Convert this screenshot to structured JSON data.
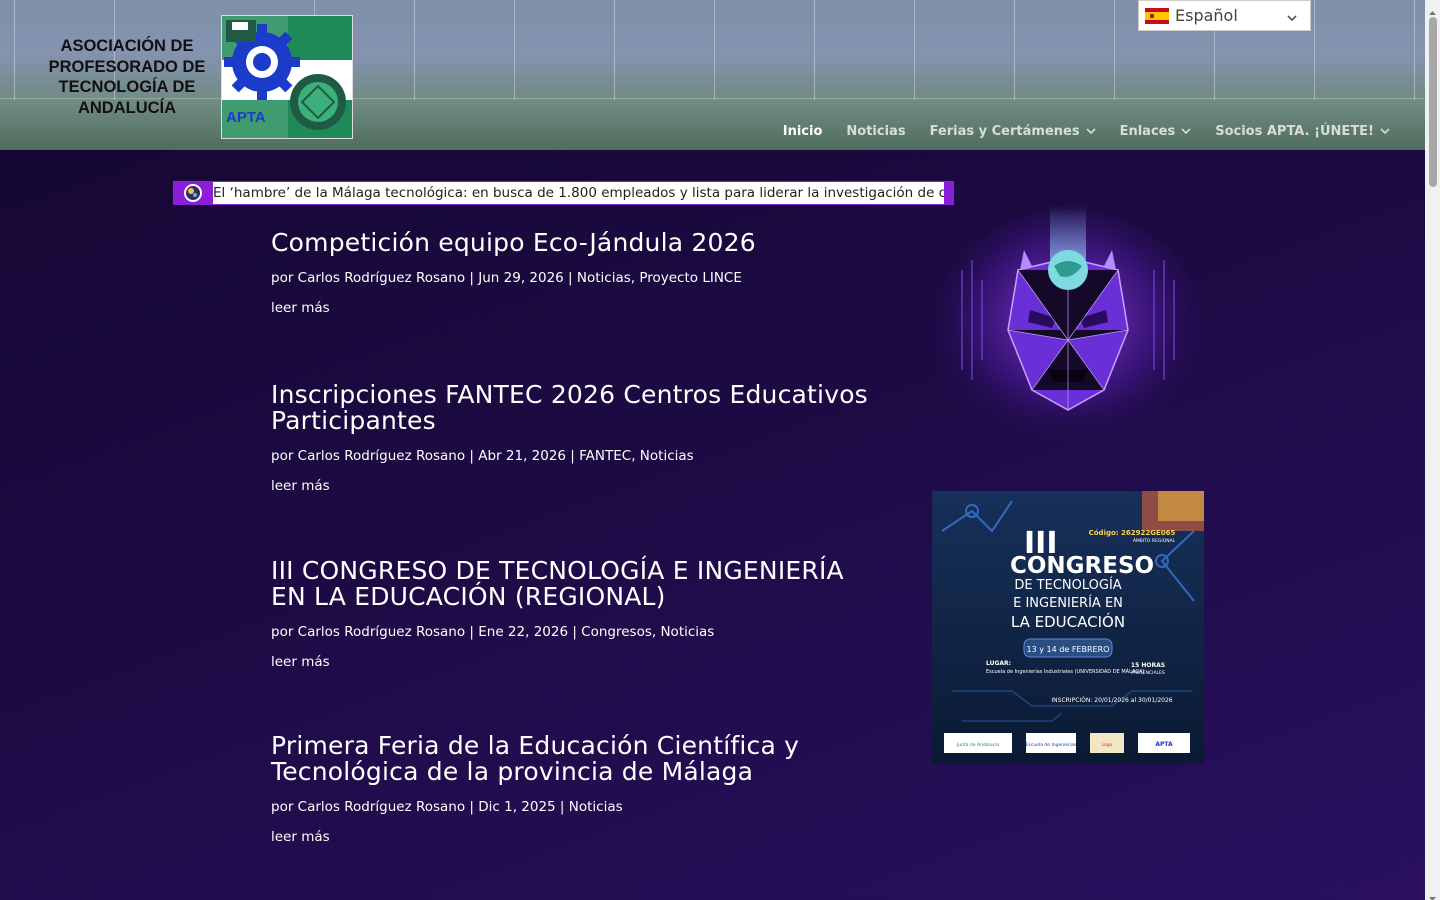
{
  "header": {
    "org_name": "ASOCIACIÓN DE PROFESORADO DE TECNOLOGÍA DE ANDALUCÍA",
    "logo_label": "APTA",
    "language": {
      "selected": "Español",
      "icon": "spain-flag-icon"
    },
    "nav": [
      {
        "label": "Inicio",
        "active": true,
        "dropdown": false
      },
      {
        "label": "Noticias",
        "active": false,
        "dropdown": false
      },
      {
        "label": "Ferias y Certámenes",
        "active": false,
        "dropdown": true
      },
      {
        "label": "Enlaces",
        "active": false,
        "dropdown": true
      },
      {
        "label": "Socios APTA. ¡ÚNETE!",
        "active": false,
        "dropdown": true
      }
    ]
  },
  "ticker": {
    "text": "El ‘hambre’ de la Málaga tecnológica: en busca de 1.800 empleados y lista para liderar la investigación de chips"
  },
  "posts": [
    {
      "title": "Competición equipo Eco-Jándula 2026",
      "meta": "por Carlos Rodríguez Rosano | Jun 29, 2026 | Noticias, Proyecto LINCE",
      "more": "leer más"
    },
    {
      "title": "Inscripciones FANTEC 2026 Centros Educativos Participantes",
      "meta": "por Carlos Rodríguez Rosano | Abr 21, 2026 | FANTEC, Noticias",
      "more": "leer más"
    },
    {
      "title": "III CONGRESO DE TECNOLOGÍA E INGENIERÍA EN LA EDUCACIÓN (REGIONAL)",
      "meta": "por Carlos Rodríguez Rosano | Ene 22, 2026 | Congresos, Noticias",
      "more": "leer más"
    },
    {
      "title": "Primera Feria de la Educación Científica y Tecnológica de la provincia de Málaga",
      "meta": "por Carlos Rodríguez Rosano | Dic 1, 2025 | Noticias",
      "more": "leer más"
    }
  ],
  "sidebar": {
    "congreso": {
      "code": "Código: 262922GE065",
      "scope": "ÁMBITO REGIONAL",
      "numeral": "III",
      "title1": "CONGRESO",
      "title2": "DE TECNOLOGÍA",
      "title3": "E INGENIERÍA EN",
      "title4": "LA EDUCACIÓN",
      "dates": "13 y 14 de FEBRERO",
      "place_label": "LUGAR:",
      "place": "Escuela de Ingenierías Industriales (UNIVERSIDAD DE MÁLAGA)",
      "hours": "15 HORAS",
      "hours_sub": "PRESENCIALES",
      "inscription": "INSCRIPCIÓN: 20/01/2026 al 30/01/2026",
      "footer_logos": [
        "Junta de Andalucía",
        "Escuela de Ingenierías",
        "Logo",
        "APTA"
      ]
    }
  },
  "colors": {
    "background": "#1c0a42",
    "ticker_accent": "#8b1ed8",
    "header_green": "#4f6c5d"
  }
}
